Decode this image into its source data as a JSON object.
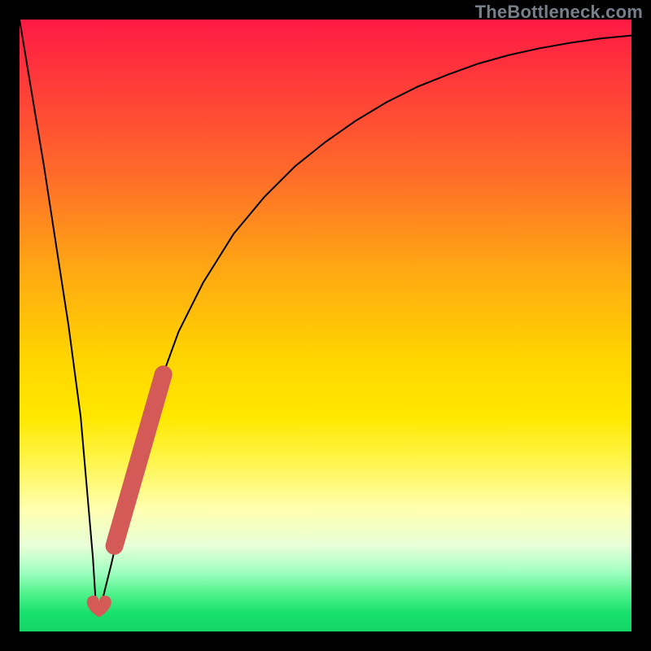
{
  "watermark": "TheBottleneck.com",
  "chart_data": {
    "type": "line",
    "title": "",
    "xlabel": "",
    "ylabel": "",
    "xlim": [
      0,
      100
    ],
    "ylim": [
      0,
      100
    ],
    "grid": false,
    "series": [
      {
        "name": "bottleneck-curve",
        "x": [
          0,
          2,
          4,
          6,
          8,
          10,
          12,
          12.5,
          13,
          15,
          18,
          22,
          26,
          30,
          35,
          40,
          45,
          50,
          55,
          60,
          65,
          70,
          75,
          80,
          85,
          90,
          95,
          100
        ],
        "y": [
          100,
          88,
          76,
          63,
          50,
          35,
          12,
          4,
          3,
          11,
          24,
          38,
          49,
          57,
          65,
          71,
          76,
          80,
          83.5,
          86.5,
          89,
          91,
          92.8,
          94.2,
          95.3,
          96.2,
          96.9,
          97.4
        ],
        "color": "#000000",
        "stroke_width": 2
      }
    ],
    "markers": [
      {
        "name": "highlight-band",
        "shape": "thick-line",
        "color": "#d35a56",
        "x": [
          15.5,
          23.5
        ],
        "y": [
          14,
          42
        ],
        "width": 22
      },
      {
        "name": "heart-marker",
        "shape": "heart",
        "color": "#d35a56",
        "x": 13,
        "y": 4,
        "size": 28
      }
    ]
  }
}
